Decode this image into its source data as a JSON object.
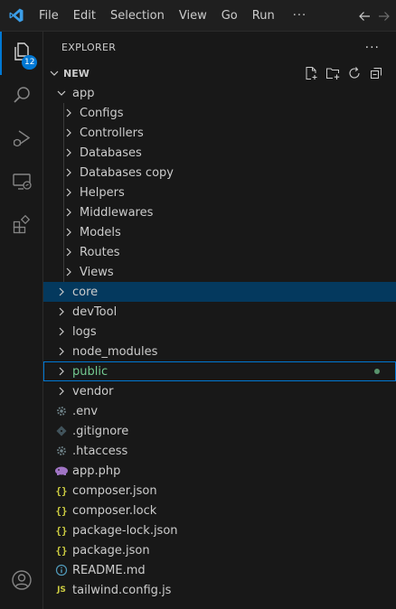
{
  "menu": [
    "File",
    "Edit",
    "Selection",
    "View",
    "Go",
    "Run"
  ],
  "menu_more": "···",
  "activity": {
    "explorer_badge": "12"
  },
  "sidebar": {
    "title": "EXPLORER",
    "more": "···",
    "section_title": "NEW"
  },
  "tree": [
    {
      "label": "app",
      "depth": 1,
      "type": "folder",
      "expanded": true
    },
    {
      "label": "Configs",
      "depth": 2,
      "type": "folder",
      "expanded": false
    },
    {
      "label": "Controllers",
      "depth": 2,
      "type": "folder",
      "expanded": false
    },
    {
      "label": "Databases",
      "depth": 2,
      "type": "folder",
      "expanded": false
    },
    {
      "label": "Databases copy",
      "depth": 2,
      "type": "folder",
      "expanded": false
    },
    {
      "label": "Helpers",
      "depth": 2,
      "type": "folder",
      "expanded": false
    },
    {
      "label": "Middlewares",
      "depth": 2,
      "type": "folder",
      "expanded": false
    },
    {
      "label": "Models",
      "depth": 2,
      "type": "folder",
      "expanded": false
    },
    {
      "label": "Routes",
      "depth": 2,
      "type": "folder",
      "expanded": false
    },
    {
      "label": "Views",
      "depth": 2,
      "type": "folder",
      "expanded": false
    },
    {
      "label": "core",
      "depth": 1,
      "type": "folder",
      "expanded": false,
      "state": "selected"
    },
    {
      "label": "devTool",
      "depth": 1,
      "type": "folder",
      "expanded": false
    },
    {
      "label": "logs",
      "depth": 1,
      "type": "folder",
      "expanded": false
    },
    {
      "label": "node_modules",
      "depth": 1,
      "type": "folder",
      "expanded": false
    },
    {
      "label": "public",
      "depth": 1,
      "type": "folder",
      "expanded": false,
      "state": "focused",
      "git": "untracked"
    },
    {
      "label": "vendor",
      "depth": 1,
      "type": "folder",
      "expanded": false
    },
    {
      "label": ".env",
      "depth": 1,
      "type": "file",
      "icon": "gear-icon",
      "color": "#6d8086"
    },
    {
      "label": ".gitignore",
      "depth": 1,
      "type": "file",
      "icon": "git-diamond-icon",
      "color": "#41535b"
    },
    {
      "label": ".htaccess",
      "depth": 1,
      "type": "file",
      "icon": "gear-icon",
      "color": "#6d8086"
    },
    {
      "label": "app.php",
      "depth": 1,
      "type": "file",
      "icon": "php-elephant-icon",
      "color": "#a074c4"
    },
    {
      "label": "composer.json",
      "depth": 1,
      "type": "file",
      "icon": "json-braces-icon",
      "color": "#cbcb41"
    },
    {
      "label": "composer.lock",
      "depth": 1,
      "type": "file",
      "icon": "json-braces-icon",
      "color": "#cbcb41"
    },
    {
      "label": "package-lock.json",
      "depth": 1,
      "type": "file",
      "icon": "json-braces-icon",
      "color": "#cbcb41"
    },
    {
      "label": "package.json",
      "depth": 1,
      "type": "file",
      "icon": "json-braces-icon",
      "color": "#cbcb41"
    },
    {
      "label": "README.md",
      "depth": 1,
      "type": "file",
      "icon": "info-icon",
      "color": "#519aba"
    },
    {
      "label": "tailwind.config.js",
      "depth": 1,
      "type": "file",
      "icon": "js-icon",
      "color": "#cbcb41"
    }
  ],
  "colors": {
    "accent": "#0078d4",
    "selected_bg": "#04395e",
    "untracked": "#73c991"
  }
}
